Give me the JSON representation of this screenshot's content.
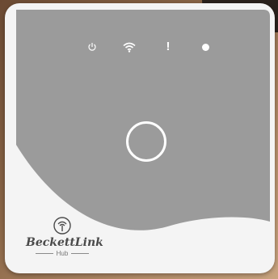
{
  "device": {
    "brand": "BeckettLink",
    "product": "Hub",
    "leds": [
      {
        "icon": "power-icon",
        "color": "#ffffff"
      },
      {
        "icon": "wifi-icon",
        "color": "#ffffff"
      },
      {
        "icon": "alert-icon",
        "label": "!",
        "color": "#ffffff"
      },
      {
        "icon": "status-dot-icon",
        "color": "#ffffff"
      }
    ],
    "colors": {
      "face": "#9b9b9b",
      "body": "#f4f4f4",
      "logo": "#4a4a4a"
    }
  }
}
